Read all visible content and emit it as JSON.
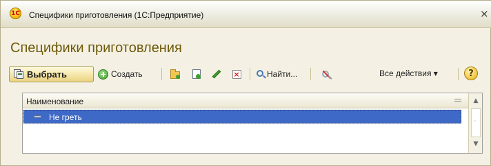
{
  "window": {
    "title": "Специфики приготовления  (1С:Предприятие)",
    "logo_text": "1С",
    "close_glyph": "×"
  },
  "form": {
    "title": "Специфики приготовления"
  },
  "toolbar": {
    "select_label": "Выбрать",
    "create_label": "Создать",
    "find_label": "Найти...",
    "all_actions_label": "Все действия ▾",
    "help_glyph": "?",
    "icons": [
      "select-icon",
      "create-icon",
      "create-folder-icon",
      "copy-icon",
      "edit-icon",
      "delete-icon",
      "search-icon",
      "clear-search-icon",
      "help-icon"
    ]
  },
  "table": {
    "columns": [
      "Наименование"
    ],
    "rows": [
      {
        "name": "Не греть",
        "selected": true
      }
    ]
  },
  "colors": {
    "title_accent": "#6e5a0a",
    "selection": "#3e69c6",
    "primary_button": "#f5e6a8"
  }
}
